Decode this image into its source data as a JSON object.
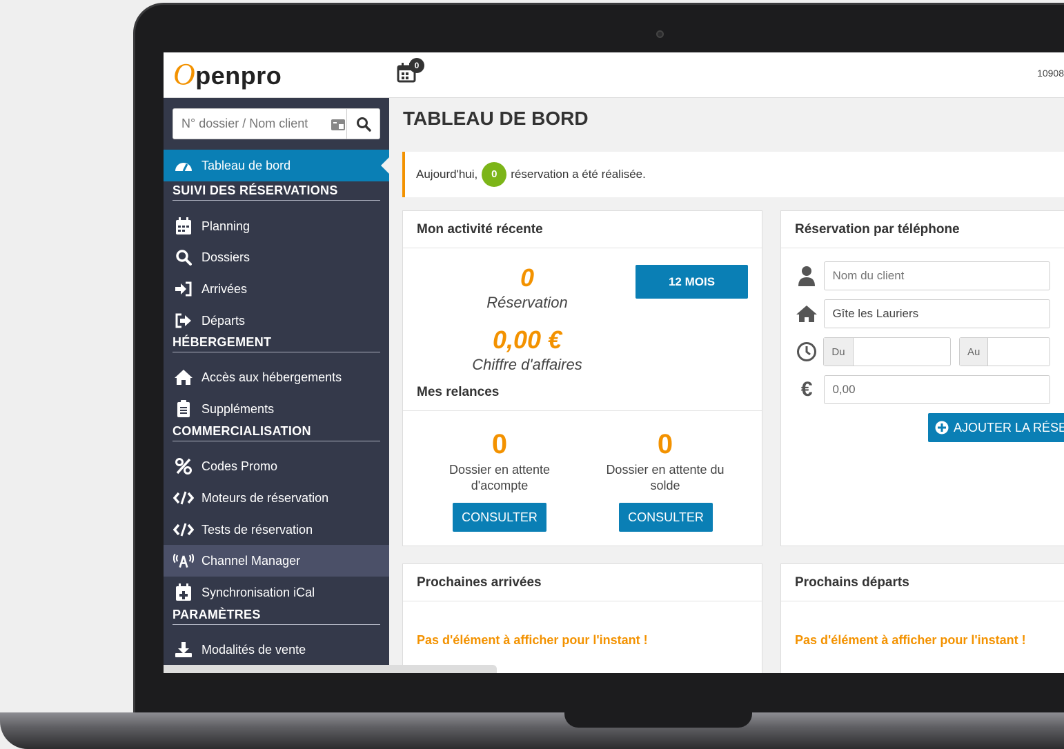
{
  "topbar": {
    "logo_o": "O",
    "logo_rest": "penpro",
    "calendar_badge": "0",
    "user_id": "10908"
  },
  "sidebar": {
    "search_placeholder": "N° dossier / Nom client",
    "active_item": "Tableau de bord",
    "sections": {
      "suivi": "SUIVI DES RÉSERVATIONS",
      "hebergement": "HÉBERGEMENT",
      "commercialisation": "COMMERCIALISATION",
      "parametres": "PARAMÈTRES"
    },
    "items": {
      "planning": "Planning",
      "dossiers": "Dossiers",
      "arrivees": "Arrivées",
      "departs": "Départs",
      "acces": "Accès aux hébergements",
      "supplements": "Suppléments",
      "codes_promo": "Codes Promo",
      "moteurs": "Moteurs de réservation",
      "tests": "Tests de réservation",
      "channel": "Channel Manager",
      "ical": "Synchronisation iCal",
      "modalites": "Modalités de vente"
    }
  },
  "main": {
    "title": "TABLEAU DE BORD",
    "alert": {
      "prefix": "Aujourd'hui,",
      "count": "0",
      "suffix": "réservation a été réalisée."
    },
    "activity": {
      "title": "Mon activité récente",
      "reservations_value": "0",
      "reservations_label": "Réservation",
      "revenue_value": "0,00 €",
      "revenue_label": "Chiffre d'affaires",
      "period_button": "12 MOIS",
      "relances_title": "Mes relances",
      "acompte_value": "0",
      "acompte_label_1": "Dossier en attente",
      "acompte_label_2": "d'acompte",
      "solde_value": "0",
      "solde_label_1": "Dossier en attente du",
      "solde_label_2": "solde",
      "consult_button": "CONSULTER"
    },
    "phone": {
      "title": "Réservation par téléphone",
      "client_placeholder": "Nom du client",
      "lodging_value": "Gîte les Lauriers",
      "from_label": "Du",
      "to_label": "Au",
      "amount_value": "0,00",
      "add_button": "AJOUTER LA RÉSER"
    },
    "arrivals": {
      "title": "Prochaines arrivées",
      "empty": "Pas d'élément à afficher pour l'instant !"
    },
    "departures": {
      "title": "Prochains départs",
      "empty": "Pas d'élément à afficher pour l'instant !"
    }
  },
  "colors": {
    "accent_blue": "#0a7fb5",
    "accent_orange": "#f39200",
    "sidebar_bg": "#34394a",
    "badge_green": "#7cb518"
  }
}
